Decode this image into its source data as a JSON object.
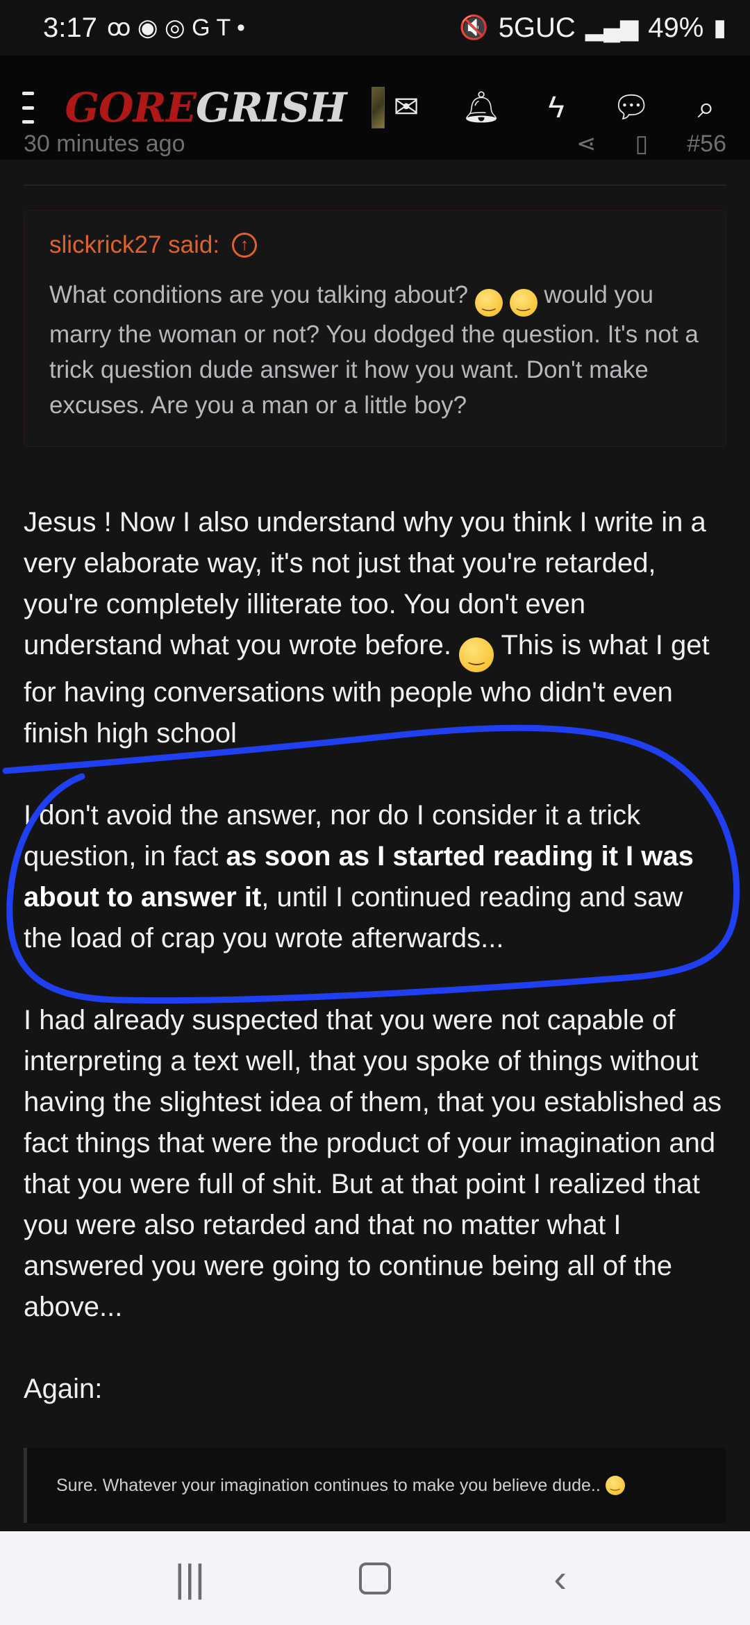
{
  "status_bar": {
    "time": "3:17",
    "left_icons": "ꝏ ◉ ◎ G T •",
    "network": "5GUC",
    "battery": "49%"
  },
  "nav": {
    "logo_part1": "GORE",
    "logo_part2": "GRISH",
    "icons": [
      "menu-icon",
      "mail-icon",
      "bell-icon",
      "lightning-icon",
      "chat-icon",
      "search-icon"
    ]
  },
  "post_meta": {
    "time": "30 minutes ago",
    "post_number": "#56"
  },
  "quote": {
    "author_label": "slickrick27 said:",
    "text_a": "What conditions are you talking about?",
    "text_b": "would you marry the woman or not? You dodged the question. It's not a trick question dude answer it how you want. Don't make excuses. Are you a man or a little boy?"
  },
  "post": {
    "p1_a": "Jesus ! Now I also understand why you think I write in a very elaborate way, it's not just that you're retarded, you're completely illiterate too. You don't even understand what you wrote before.",
    "p1_b": "This is what I get for having conversations with people who didn't even finish high school",
    "p2_a": "I don't avoid the answer, nor do I consider it a trick question, in fact",
    "p2_bold": "as soon as I started reading it I was about to answer it",
    "p2_b": ", until I continued reading and saw the load of crap you wrote afterwards...",
    "p3": "I had already suspected that you were not capable of interpreting a text well, that you spoke of things without having the slightest idea of them, that you established as fact things that were the product of your imagination and that you were full of shit. But at that point I realized that you were also retarded and that no matter what I answered you were going to continue being all of the above...",
    "p4": "Again:"
  },
  "inner_quote": {
    "text": "Sure. Whatever your imagination continues to make you believe dude.."
  },
  "colors": {
    "accent": "#e0612c",
    "annotation": "#1f3ff0",
    "brand_red": "#b01818"
  }
}
